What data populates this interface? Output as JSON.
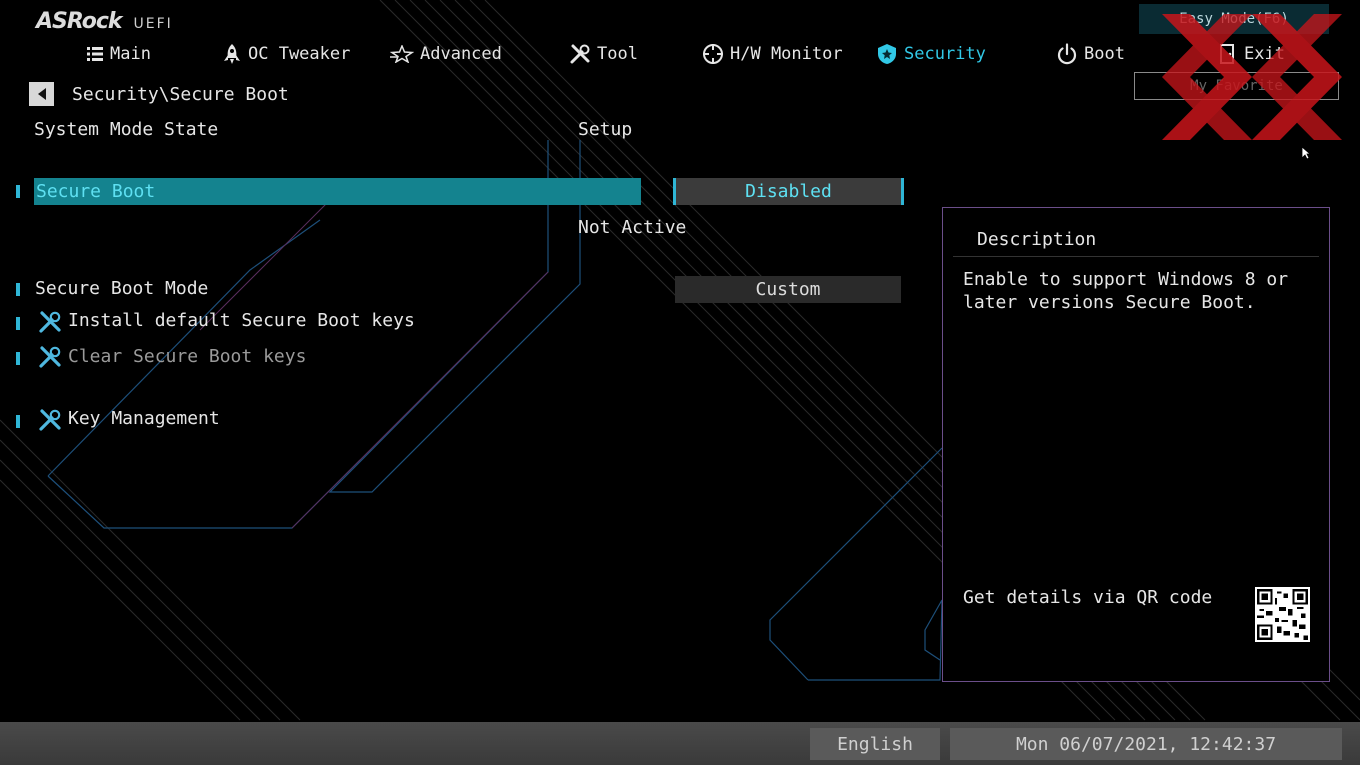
{
  "brand": {
    "name": "ASRock",
    "product": "UEFI"
  },
  "header": {
    "easy_mode_label": "Easy Mode(F6)",
    "my_favorite_label": "My Favorite"
  },
  "nav": {
    "active": "Security",
    "items": [
      {
        "label": "Main",
        "icon": "list-icon"
      },
      {
        "label": "OC Tweaker",
        "icon": "rocket-icon"
      },
      {
        "label": "Advanced",
        "icon": "star-icon"
      },
      {
        "label": "Tool",
        "icon": "tools-icon"
      },
      {
        "label": "H/W Monitor",
        "icon": "crosshair-icon"
      },
      {
        "label": "Security",
        "icon": "shield-icon"
      },
      {
        "label": "Boot",
        "icon": "power-icon"
      },
      {
        "label": "Exit",
        "icon": "exit-door-icon"
      }
    ]
  },
  "page": {
    "breadcrumb": "Security\\Secure Boot",
    "system_mode_state_label": "System Mode State",
    "system_mode_state_value": "Setup",
    "secure_boot_label": "Secure Boot",
    "secure_boot_value": "Disabled",
    "secure_boot_status": "Not Active",
    "secure_boot_mode_label": "Secure Boot Mode",
    "secure_boot_mode_value": "Custom",
    "install_keys_label": "Install default Secure Boot keys",
    "clear_keys_label": "Clear Secure Boot keys",
    "key_management_label": "Key Management"
  },
  "description": {
    "title": "Description",
    "text": "Enable to support Windows 8 or later versions Secure Boot.",
    "qr_label": "Get details via QR code"
  },
  "footer": {
    "language": "English",
    "datetime": "Mon 06/07/2021, 12:42:37"
  },
  "colors": {
    "accent": "#31c8e6",
    "selected_row": "#14838f",
    "panel_border": "#6b4e8a",
    "watermark": "#c8151b"
  }
}
